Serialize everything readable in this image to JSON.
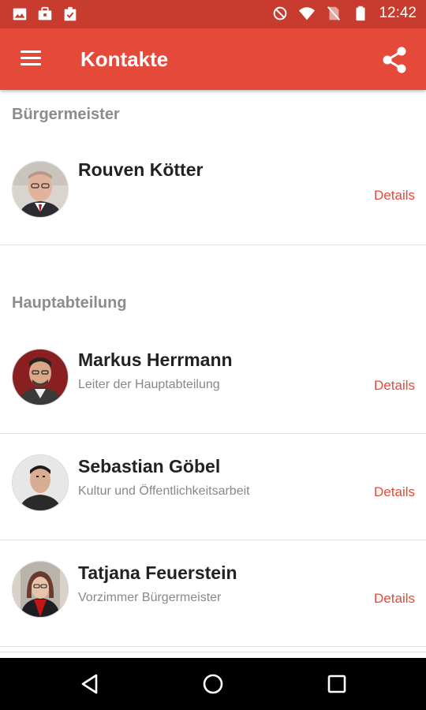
{
  "status_bar": {
    "time": "12:42",
    "left_icons": [
      "image-icon",
      "briefcase-icon",
      "clipboard-check-icon"
    ],
    "right_icons": [
      "do-not-disturb-icon",
      "wifi-icon",
      "no-sim-icon",
      "battery-icon"
    ]
  },
  "app_bar": {
    "title": "Kontakte",
    "background": "#e5493a",
    "status_background": "#c73c2f"
  },
  "sections": [
    {
      "header": "Bürgermeister",
      "contacts": [
        {
          "name": "Rouven Kötter",
          "role": "",
          "details_label": "Details"
        }
      ]
    },
    {
      "header": "Hauptabteilung",
      "contacts": [
        {
          "name": "Markus Herrmann",
          "role": "Leiter der Hauptabteilung",
          "details_label": "Details"
        },
        {
          "name": "Sebastian Göbel",
          "role": "Kultur und Öffentlichkeitsarbeit",
          "details_label": "Details"
        },
        {
          "name": "Tatjana Feuerstein",
          "role": "Vorzimmer Bürgermeister",
          "details_label": "Details"
        }
      ]
    }
  ],
  "nav_bar": {
    "buttons": [
      "back-icon",
      "home-icon",
      "recents-icon"
    ]
  },
  "colors": {
    "accent": "#e5493a",
    "section_header": "#8c8c8c",
    "name_text": "#222222",
    "role_text": "#888888"
  }
}
